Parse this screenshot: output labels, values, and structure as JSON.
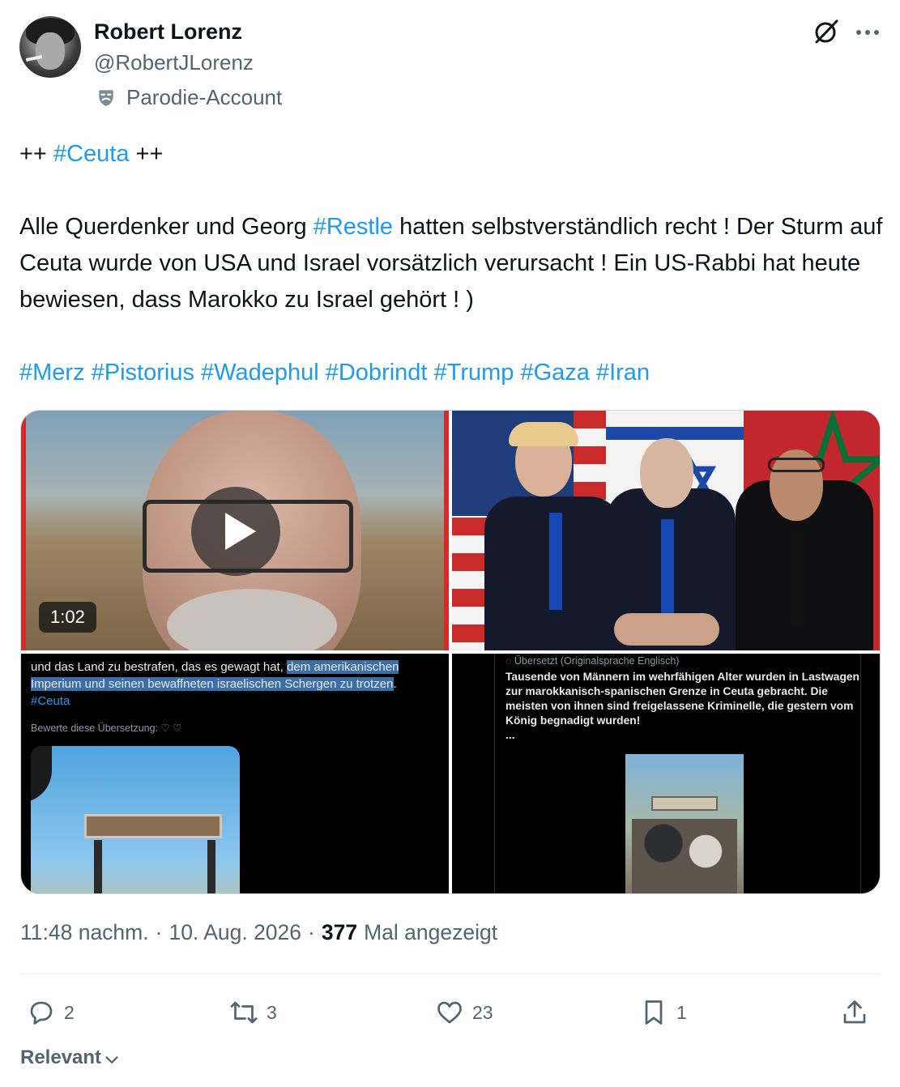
{
  "author": {
    "name": "Robert Lorenz",
    "handle": "@RobertJLorenz",
    "label": "Parodie-Account"
  },
  "tweet": {
    "line1_prefix": "++ ",
    "line1_tag": "#Ceuta",
    "line1_suffix": " ++",
    "body_part1": "Alle Querdenker und Georg ",
    "body_tag": "#Restle",
    "body_part2": " hatten selbstverständlich recht ! Der Sturm auf Ceuta wurde von USA und Israel vorsätzlich verursacht ! Ein US-Rabbi hat heute bewiesen, dass Marokko zu Israel gehört ! )",
    "hashtags": [
      "#Merz",
      "#Pistorius",
      "#Wadephul",
      "#Dobrindt",
      "#Trump",
      "#Gaza",
      "#Iran"
    ]
  },
  "media": {
    "video_duration": "1:02",
    "screenshot1": {
      "text_plain": "und das Land zu bestrafen, das es gewagt hat, ",
      "text_highlight1": "dem amerikanischen",
      "text_highlight2": "Imperium und seinen bewaffneten israelischen Schergen zu trotzen",
      "text_end": ".",
      "tag": "#Ceuta",
      "rate_label": "Bewerte diese Übersetzung:"
    },
    "screenshot2": {
      "translated_label": "Übersetzt (Originalsprache Englisch)",
      "text": "Tausende von Männern im wehrfähigen Alter wurden in Lastwagen zur marokkanisch-spanischen Grenze in Ceuta gebracht. Die meisten von ihnen sind freigelassene Kriminelle, die gestern vom König begnadigt wurden!",
      "ellipsis": "..."
    }
  },
  "meta": {
    "time": "11:48 nachm.",
    "sep": "·",
    "date": "10. Aug. 2026",
    "views_count": "377",
    "views_label": "Mal angezeigt"
  },
  "actions": {
    "replies": "2",
    "reposts": "3",
    "likes": "23",
    "bookmarks": "1"
  },
  "sort": {
    "label": "Relevant"
  },
  "colors": {
    "link": "#1d9bf0",
    "secondary_text": "#536471",
    "primary_text": "#0f1419",
    "divider": "#eff3f4"
  },
  "icons": [
    "grok-icon",
    "more-icon",
    "parody-mask-icon",
    "play-icon",
    "reply-icon",
    "repost-icon",
    "like-icon",
    "bookmark-icon",
    "share-icon",
    "chevron-down-icon"
  ]
}
